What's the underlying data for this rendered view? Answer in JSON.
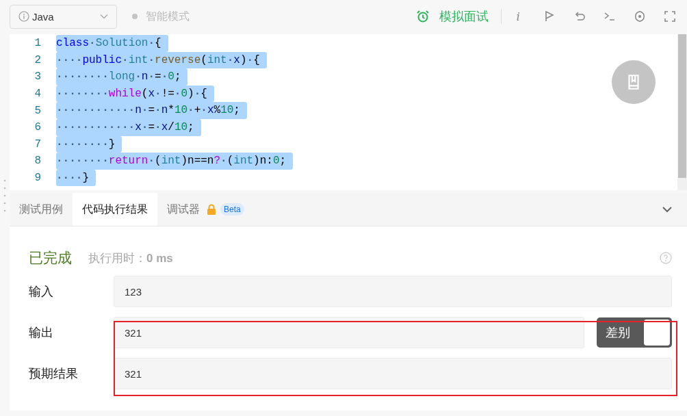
{
  "toolbar": {
    "language": "Java",
    "mode_label": "智能模式",
    "interview_label": "模拟面试",
    "info_label": "i"
  },
  "editor": {
    "lines": [
      {
        "number": "1",
        "tokens": [
          {
            "kind": "kw",
            "text": "class"
          },
          {
            "kind": "ws",
            "text": "·"
          },
          {
            "kind": "type",
            "text": "Solution"
          },
          {
            "kind": "ws",
            "text": "·"
          },
          {
            "kind": "plain",
            "text": "{"
          }
        ]
      },
      {
        "number": "2",
        "tokens": [
          {
            "kind": "ws",
            "text": "····"
          },
          {
            "kind": "kw",
            "text": "public"
          },
          {
            "kind": "ws",
            "text": "·"
          },
          {
            "kind": "type",
            "text": "int"
          },
          {
            "kind": "ws",
            "text": "·"
          },
          {
            "kind": "func",
            "text": "reverse"
          },
          {
            "kind": "plain",
            "text": "("
          },
          {
            "kind": "type",
            "text": "int"
          },
          {
            "kind": "ws",
            "text": "·"
          },
          {
            "kind": "var",
            "text": "x"
          },
          {
            "kind": "plain",
            "text": ")"
          },
          {
            "kind": "ws",
            "text": "·"
          },
          {
            "kind": "plain",
            "text": "{"
          }
        ]
      },
      {
        "number": "3",
        "tokens": [
          {
            "kind": "ws",
            "text": "········"
          },
          {
            "kind": "type",
            "text": "long"
          },
          {
            "kind": "ws",
            "text": "·"
          },
          {
            "kind": "var",
            "text": "n"
          },
          {
            "kind": "ws",
            "text": "·"
          },
          {
            "kind": "plain",
            "text": "="
          },
          {
            "kind": "ws",
            "text": "·"
          },
          {
            "kind": "num",
            "text": "0"
          },
          {
            "kind": "plain",
            "text": ";"
          }
        ]
      },
      {
        "number": "4",
        "tokens": [
          {
            "kind": "ws",
            "text": "········"
          },
          {
            "kind": "ctrl",
            "text": "while"
          },
          {
            "kind": "plain",
            "text": "("
          },
          {
            "kind": "var",
            "text": "x"
          },
          {
            "kind": "ws",
            "text": "·"
          },
          {
            "kind": "plain",
            "text": "!="
          },
          {
            "kind": "ws",
            "text": "·"
          },
          {
            "kind": "num",
            "text": "0"
          },
          {
            "kind": "plain",
            "text": ")"
          },
          {
            "kind": "ws",
            "text": "·"
          },
          {
            "kind": "plain",
            "text": "{"
          }
        ]
      },
      {
        "number": "5",
        "tokens": [
          {
            "kind": "ws",
            "text": "············"
          },
          {
            "kind": "var",
            "text": "n"
          },
          {
            "kind": "ws",
            "text": "·"
          },
          {
            "kind": "plain",
            "text": "="
          },
          {
            "kind": "ws",
            "text": "·"
          },
          {
            "kind": "var",
            "text": "n"
          },
          {
            "kind": "plain",
            "text": "*"
          },
          {
            "kind": "num",
            "text": "10"
          },
          {
            "kind": "ws",
            "text": "·"
          },
          {
            "kind": "plain",
            "text": "+"
          },
          {
            "kind": "ws",
            "text": "·"
          },
          {
            "kind": "var",
            "text": "x"
          },
          {
            "kind": "plain",
            "text": "%"
          },
          {
            "kind": "num",
            "text": "10"
          },
          {
            "kind": "plain",
            "text": ";"
          }
        ]
      },
      {
        "number": "6",
        "tokens": [
          {
            "kind": "ws",
            "text": "············"
          },
          {
            "kind": "var",
            "text": "x"
          },
          {
            "kind": "ws",
            "text": "·"
          },
          {
            "kind": "plain",
            "text": "="
          },
          {
            "kind": "ws",
            "text": "·"
          },
          {
            "kind": "var",
            "text": "x"
          },
          {
            "kind": "plain",
            "text": "/"
          },
          {
            "kind": "num",
            "text": "10"
          },
          {
            "kind": "plain",
            "text": ";"
          }
        ]
      },
      {
        "number": "7",
        "tokens": [
          {
            "kind": "ws",
            "text": "········"
          },
          {
            "kind": "plain",
            "text": "}"
          }
        ]
      },
      {
        "number": "8",
        "tokens": [
          {
            "kind": "ws",
            "text": "········"
          },
          {
            "kind": "ctrl",
            "text": "return"
          },
          {
            "kind": "ws",
            "text": "·"
          },
          {
            "kind": "plain",
            "text": "("
          },
          {
            "kind": "type",
            "text": "int"
          },
          {
            "kind": "plain",
            "text": ")n==n"
          },
          {
            "kind": "ctrl",
            "text": "?"
          },
          {
            "kind": "ws",
            "text": "·"
          },
          {
            "kind": "plain",
            "text": "("
          },
          {
            "kind": "type",
            "text": "int"
          },
          {
            "kind": "plain",
            "text": ")n:"
          },
          {
            "kind": "num",
            "text": "0"
          },
          {
            "kind": "plain",
            "text": ";"
          }
        ]
      },
      {
        "number": "9",
        "tokens": [
          {
            "kind": "ws",
            "text": "····"
          },
          {
            "kind": "plain",
            "text": "}"
          }
        ]
      }
    ]
  },
  "tabs": [
    {
      "label": "测试用例",
      "selected": false
    },
    {
      "label": "代码执行结果",
      "selected": true
    },
    {
      "label": "调试器",
      "selected": false,
      "locked": true,
      "badge": "Beta"
    }
  ],
  "result": {
    "status": "已完成",
    "time_label": "执行用时：",
    "time_value": "0 ms",
    "rows": [
      {
        "label": "输入",
        "value": "123"
      },
      {
        "label": "输出",
        "value": "321"
      },
      {
        "label": "预期结果",
        "value": "321"
      }
    ],
    "diff_toggle": {
      "label": "差别",
      "on": true
    }
  }
}
